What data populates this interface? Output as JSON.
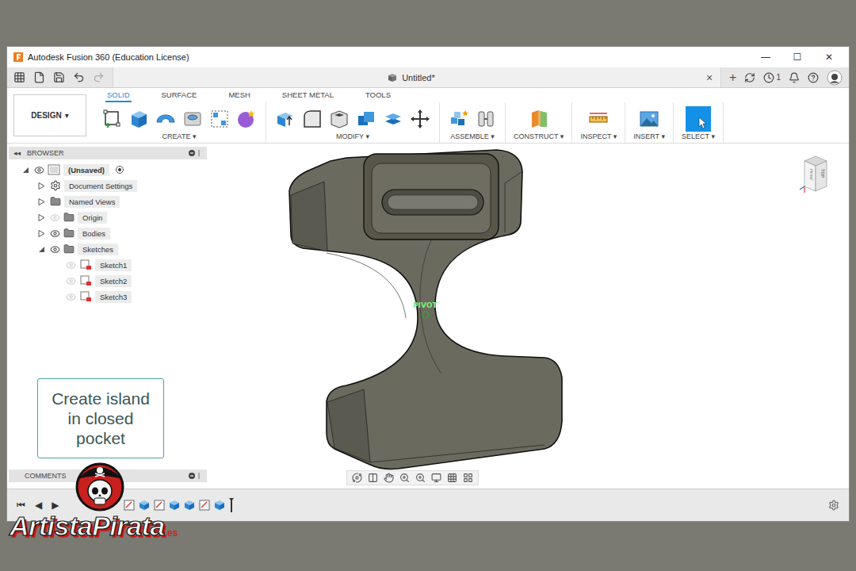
{
  "window": {
    "title": "Autodesk Fusion 360 (Education License)",
    "controls": [
      "—",
      "☐",
      "✕"
    ]
  },
  "app_bar": {
    "document": "Untitled*",
    "close": "×",
    "new": "+",
    "jobs": "1"
  },
  "workspace": {
    "label": "DESIGN",
    "caret": "▾"
  },
  "ribbon_tabs": [
    {
      "label": "SOLID",
      "selected": true
    },
    {
      "label": "SURFACE",
      "selected": false
    },
    {
      "label": "MESH",
      "selected": false
    },
    {
      "label": "SHEET METAL",
      "selected": false
    },
    {
      "label": "TOOLS",
      "selected": false
    }
  ],
  "tool_groups": [
    {
      "label": "CREATE",
      "caret": "▾"
    },
    {
      "label": "MODIFY",
      "caret": "▾"
    },
    {
      "label": "ASSEMBLE",
      "caret": "▾"
    },
    {
      "label": "CONSTRUCT",
      "caret": "▾"
    },
    {
      "label": "INSPECT",
      "caret": "▾"
    },
    {
      "label": "INSERT",
      "caret": "▾"
    },
    {
      "label": "SELECT",
      "caret": "▾"
    }
  ],
  "browser": {
    "title": "BROWSER",
    "collapse": "◂◂",
    "tree": {
      "label": "(Unsaved)",
      "kind": "root",
      "expanded": true,
      "visible": true,
      "active": true,
      "children": [
        {
          "label": "Document Settings",
          "kind": "settings",
          "expanded": false
        },
        {
          "label": "Named Views",
          "kind": "views",
          "expanded": false
        },
        {
          "label": "Origin",
          "kind": "folder",
          "expanded": false,
          "visible": false
        },
        {
          "label": "Bodies",
          "kind": "folder",
          "expanded": false,
          "visible": true
        },
        {
          "label": "Sketches",
          "kind": "folder",
          "expanded": true,
          "visible": true,
          "children": [
            {
              "label": "Sketch1",
              "kind": "sketch",
              "visible": false
            },
            {
              "label": "Sketch2",
              "kind": "sketch",
              "visible": false
            },
            {
              "label": "Sketch3",
              "kind": "sketch",
              "visible": false
            }
          ]
        }
      ]
    }
  },
  "comments": {
    "title": "COMMENTS"
  },
  "canvas": {
    "pivot": "PIVOT"
  },
  "view_cube": {
    "top": "TOP",
    "front": "FRONT"
  },
  "timeline": {
    "controls": [
      "⏮",
      "◀",
      "▶"
    ],
    "features": [
      {
        "kind": "sketch"
      },
      {
        "kind": "extrude"
      },
      {
        "kind": "sketch"
      },
      {
        "kind": "extrude"
      },
      {
        "kind": "extrude"
      },
      {
        "kind": "sketch"
      },
      {
        "kind": "extrude"
      }
    ]
  },
  "callout": {
    "text": "Create island in closed pocket"
  },
  "watermark": {
    "name": "ArtistaPirata",
    "domain": ".es"
  }
}
